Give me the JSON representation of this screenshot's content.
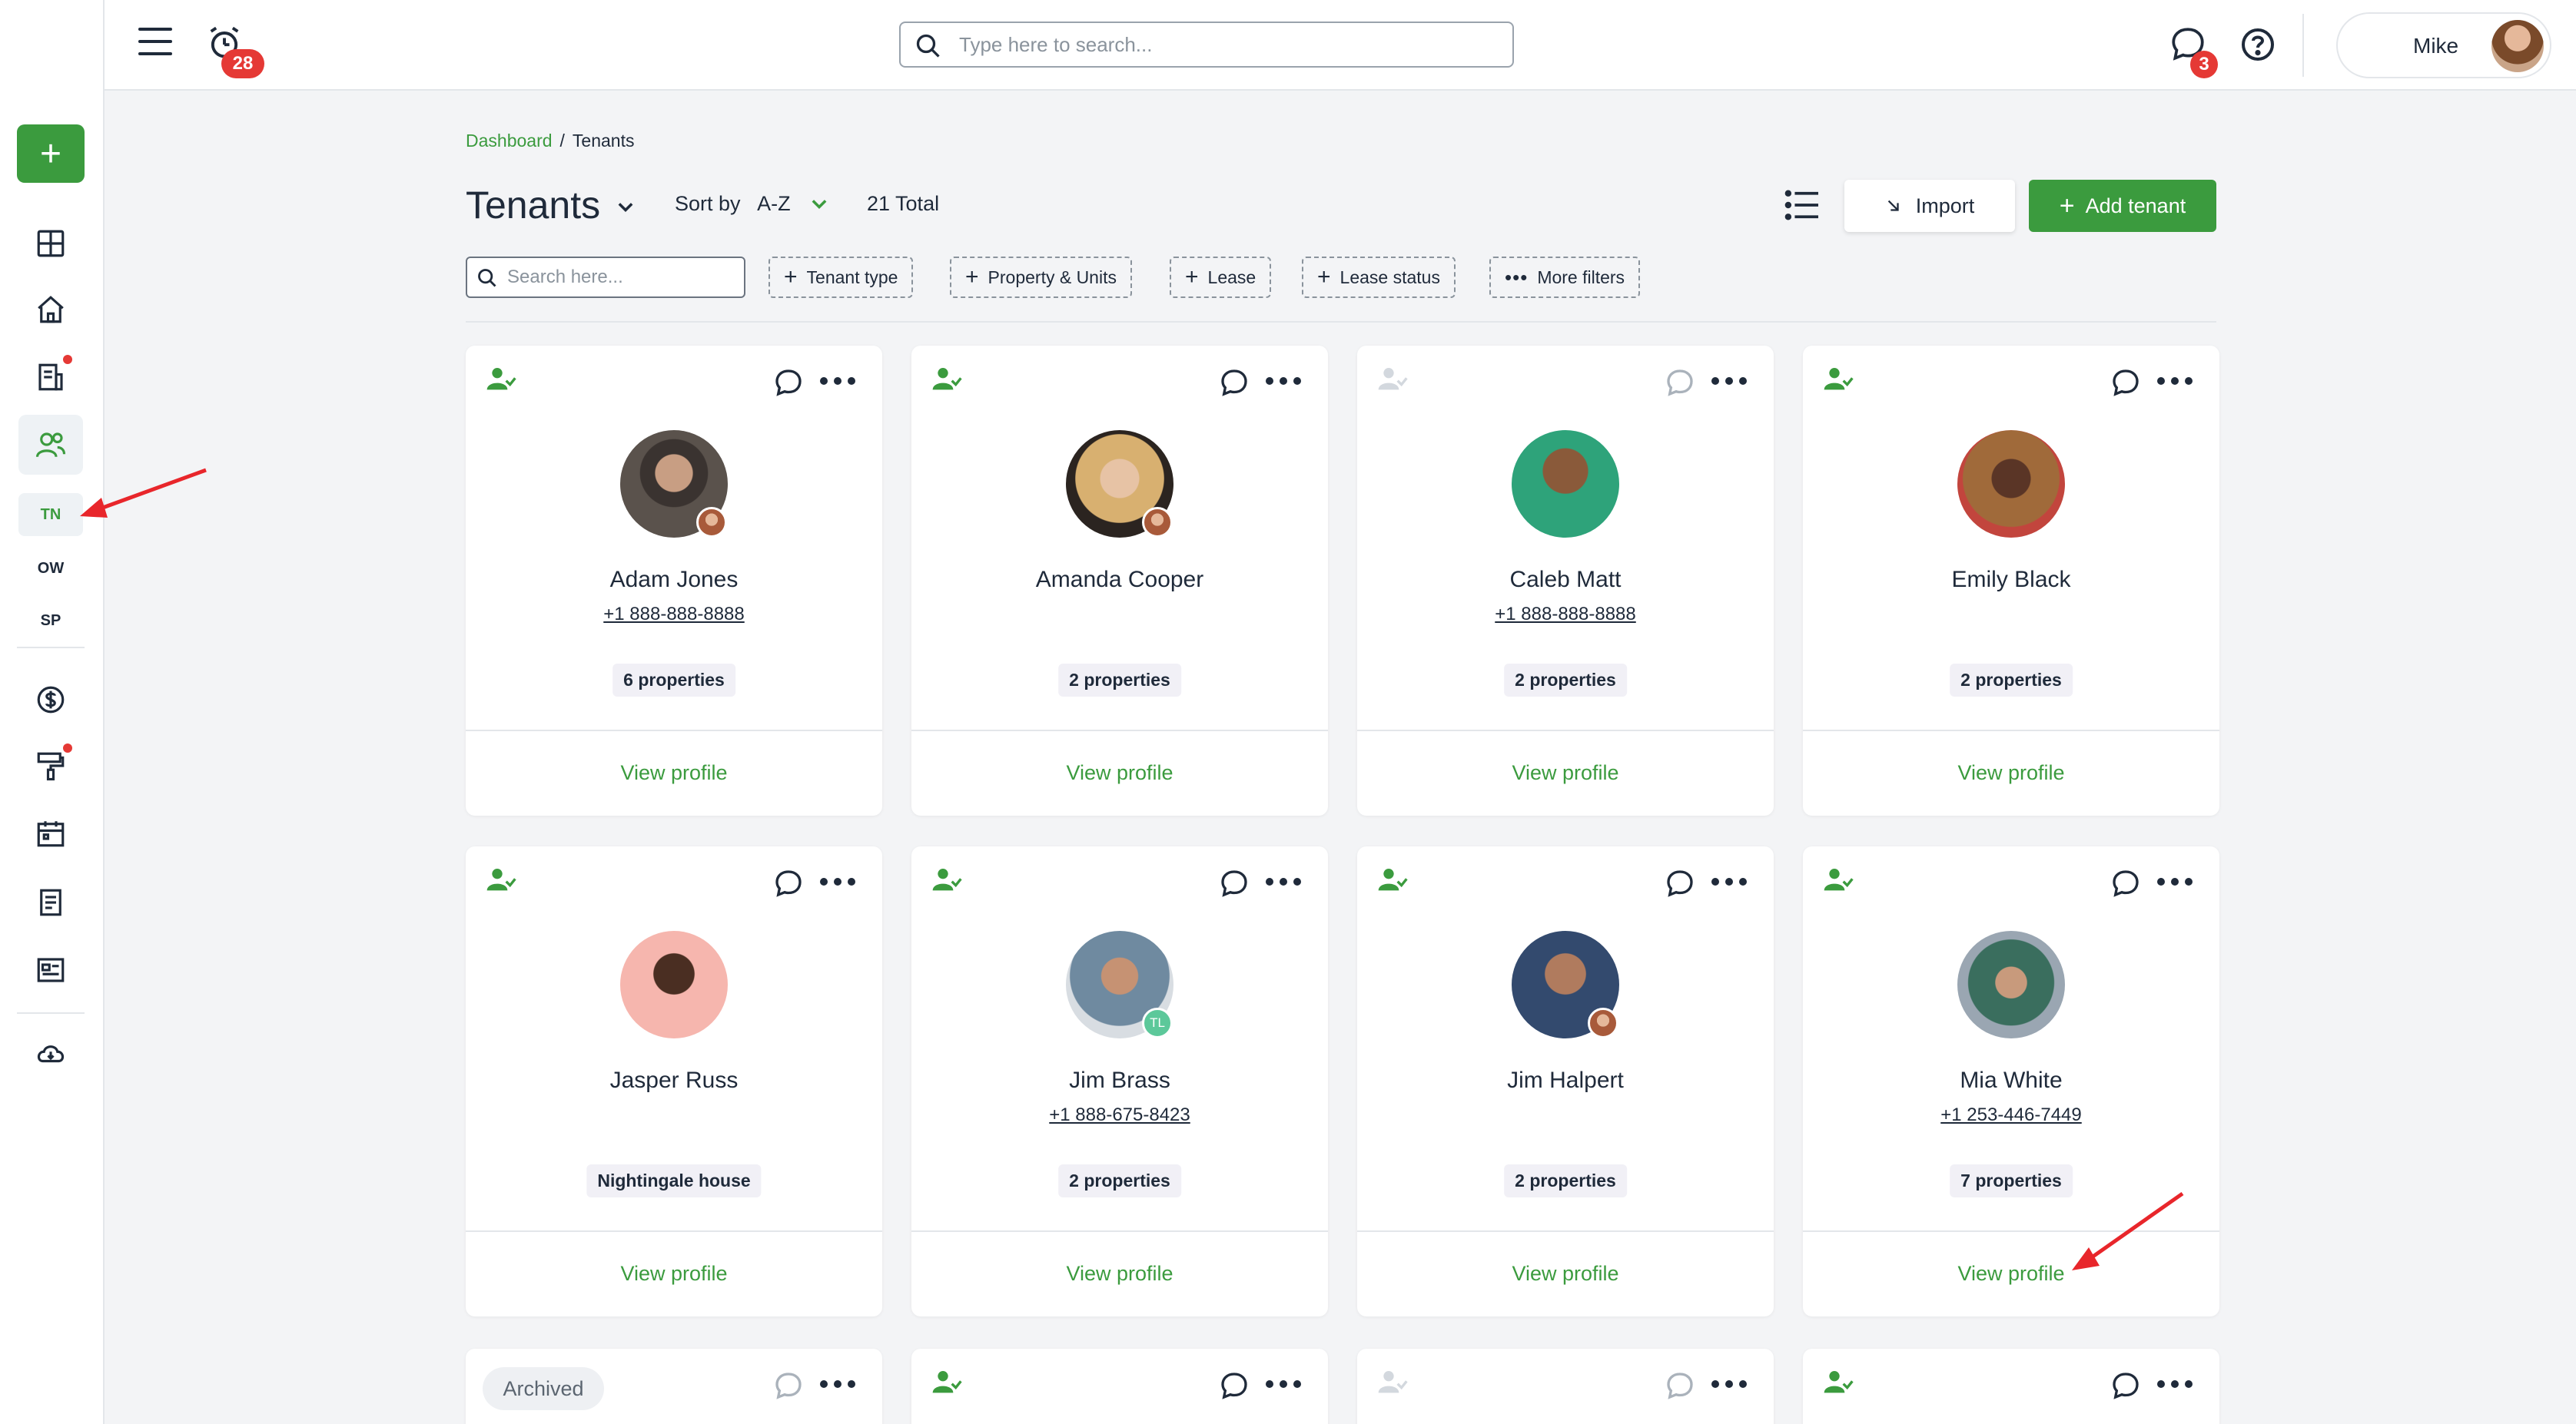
{
  "topbar": {
    "notification_count": "28",
    "message_count": "3",
    "search_placeholder": "Type here to search...",
    "user_name": "Mike"
  },
  "sidebar": {
    "sub_items": [
      "TN",
      "OW",
      "SP"
    ]
  },
  "breadcrumb": {
    "root": "Dashboard",
    "separator": "/",
    "current": "Tenants"
  },
  "header": {
    "title": "Tenants",
    "sort_label": "Sort by",
    "sort_value": "A-Z",
    "total": "21 Total",
    "import_label": "Import",
    "add_label": "Add tenant"
  },
  "filters": {
    "search_placeholder": "Search here...",
    "chips": [
      "Tenant type",
      "Property & Units",
      "Lease",
      "Lease status"
    ],
    "more_filters": "More filters"
  },
  "cards": [
    {
      "name": "Adam Jones",
      "phone": "+1 888-888-8888",
      "props": "6 properties",
      "view": "View profile"
    },
    {
      "name": "Amanda Cooper",
      "phone": "",
      "props": "2 properties",
      "view": "View profile"
    },
    {
      "name": "Caleb Matt",
      "phone": "+1 888-888-8888",
      "props": "2 properties",
      "view": "View profile"
    },
    {
      "name": "Emily Black",
      "phone": "",
      "props": "2 properties",
      "view": "View profile"
    },
    {
      "name": "Jasper Russ",
      "phone": "",
      "props": "Nightingale house",
      "view": "View profile"
    },
    {
      "name": "Jim Brass",
      "phone": "+1 888-675-8423",
      "props": "2 properties",
      "view": "View profile",
      "mini": "TL"
    },
    {
      "name": "Jim Halpert",
      "phone": "",
      "props": "2 properties",
      "view": "View profile"
    },
    {
      "name": "Mia White",
      "phone": "+1 253-446-7449",
      "props": "7 properties",
      "view": "View profile"
    }
  ],
  "archived_label": "Archived",
  "colors": {
    "accent": "#3b9b3e",
    "badge": "#e53935",
    "text": "#1f2a3a"
  }
}
